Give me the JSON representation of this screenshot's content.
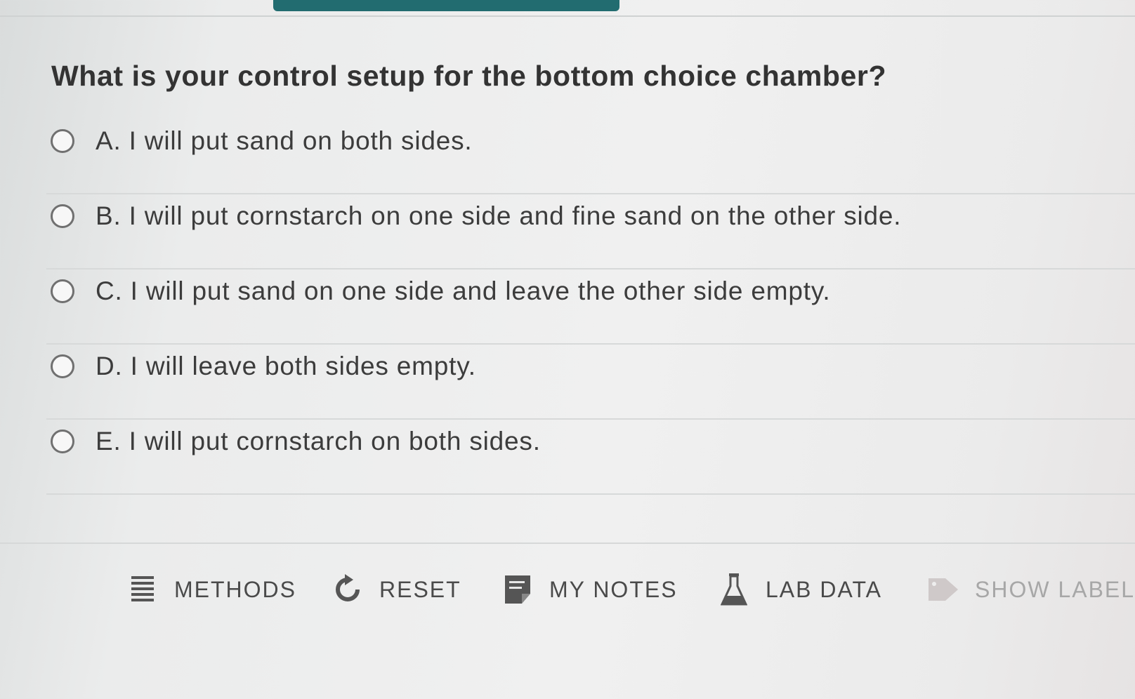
{
  "question": "What is your control setup for the bottom choice chamber?",
  "options": [
    {
      "label": "A. I will put sand on both sides."
    },
    {
      "label": "B. I will put cornstarch on one side and fine sand on the other side."
    },
    {
      "label": "C. I will put sand on one side and leave the other side empty."
    },
    {
      "label": "D. I will leave both sides empty."
    },
    {
      "label": "E. I will put cornstarch on both sides."
    }
  ],
  "toolbar": {
    "methods": {
      "label": "METHODS",
      "icon": "list-icon"
    },
    "reset": {
      "label": "RESET",
      "icon": "reset-icon"
    },
    "notes": {
      "label": "MY NOTES",
      "icon": "notes-icon"
    },
    "lab_data": {
      "label": "LAB DATA",
      "icon": "flask-icon"
    },
    "show_labels": {
      "label": "SHOW LABELS",
      "icon": "tag-icon"
    }
  },
  "colors": {
    "accent": "#226c70",
    "text": "#3c3c3c",
    "disabled": "#a7a7a7"
  }
}
